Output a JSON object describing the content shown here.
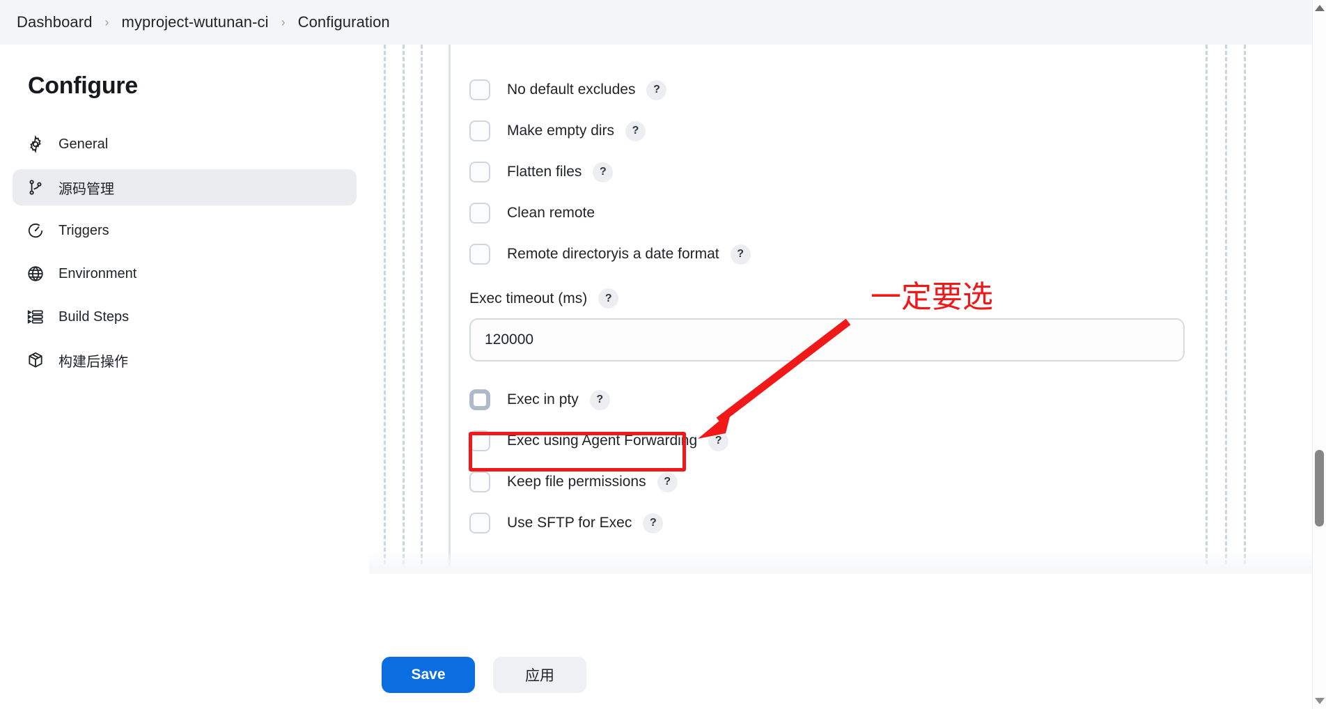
{
  "breadcrumb": {
    "separator": "›",
    "items": [
      {
        "label": "Dashboard"
      },
      {
        "label": "myproject-wutunan-ci"
      },
      {
        "label": "Configuration"
      }
    ]
  },
  "sidebar": {
    "title": "Configure",
    "items": [
      {
        "label": "General",
        "icon": "gear-icon",
        "active": false
      },
      {
        "label": "源码管理",
        "icon": "source-control-icon",
        "active": true
      },
      {
        "label": "Triggers",
        "icon": "clock-icon",
        "active": false
      },
      {
        "label": "Environment",
        "icon": "globe-icon",
        "active": false
      },
      {
        "label": "Build Steps",
        "icon": "list-steps-icon",
        "active": false
      },
      {
        "label": "构建后操作",
        "icon": "package-icon",
        "active": false
      }
    ]
  },
  "form": {
    "help_glyph": "?",
    "checkboxes_top": [
      {
        "label": "No default excludes",
        "help": true,
        "checked": false
      },
      {
        "label": "Make empty dirs",
        "help": true,
        "checked": false
      },
      {
        "label": "Flatten files",
        "help": true,
        "checked": false
      },
      {
        "label": "Clean remote",
        "help": false,
        "checked": false
      },
      {
        "label": "Remote directoryis a date format",
        "help": true,
        "checked": false
      }
    ],
    "exec_timeout": {
      "label": "Exec timeout (ms)",
      "help": true,
      "value": "120000",
      "placeholder": ""
    },
    "checkboxes_bottom": [
      {
        "label": "Exec in pty",
        "help": true,
        "checked": false,
        "focused": true
      },
      {
        "label": "Exec using Agent Forwarding",
        "help": true,
        "checked": false,
        "focused": false
      },
      {
        "label": "Keep file permissions",
        "help": true,
        "checked": false,
        "focused": false
      },
      {
        "label": "Use SFTP for Exec",
        "help": true,
        "checked": false,
        "focused": false
      }
    ]
  },
  "footer": {
    "save_label": "Save",
    "apply_label": "应用"
  },
  "annotation": {
    "text": "一定要选",
    "color": "#f01818",
    "target_label": "Exec in pty"
  },
  "colors": {
    "accent": "#0b6ee0",
    "annotation_red": "#f01818",
    "sidebar_active_bg": "#ebecf0",
    "breadcrumb_bg": "#f4f5f7",
    "guide_dash": "#ccd4e0"
  }
}
